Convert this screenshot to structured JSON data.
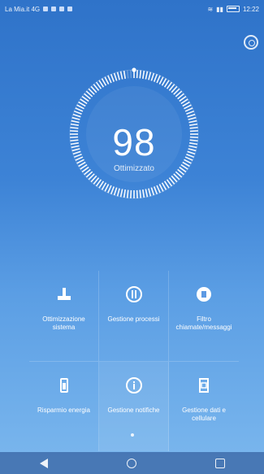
{
  "status_bar": {
    "carrier": "La Mia.it 4G",
    "time": "12:22"
  },
  "main": {
    "score": "98",
    "score_label": "Ottimizzato",
    "score_progress": 0.98
  },
  "tiles": [
    {
      "label": "Ottimizzazione sistema",
      "icon": "cleanup-icon"
    },
    {
      "label": "Gestione processi",
      "icon": "process-icon"
    },
    {
      "label": "Filtro chiamate/messaggi",
      "icon": "shield-icon"
    },
    {
      "label": "Risparmio energia",
      "icon": "battery-icon"
    },
    {
      "label": "Gestione notifiche",
      "icon": "info-icon"
    },
    {
      "label": "Gestione dati e cellulare",
      "icon": "sim-icon"
    }
  ]
}
